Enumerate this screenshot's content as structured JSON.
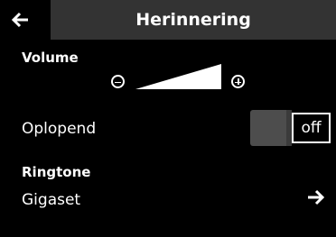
{
  "header": {
    "title": "Herinnering",
    "back_icon": "back-arrow-icon"
  },
  "volume": {
    "label": "Volume",
    "decrease_icon": "minus-circle-icon",
    "increase_icon": "plus-circle-icon",
    "level": 1.0
  },
  "crescendo": {
    "label": "Oplopend",
    "state": "off"
  },
  "ringtone": {
    "label": "Ringtone",
    "value": "Gigaset",
    "forward_icon": "forward-arrow-icon"
  },
  "colors": {
    "background": "#000000",
    "titlebar": "#333333",
    "text": "#ffffff",
    "toggle_knob": "#4d4d4d"
  }
}
